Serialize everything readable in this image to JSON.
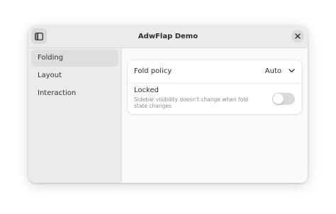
{
  "window": {
    "title": "AdwFlap Demo"
  },
  "headerbar": {
    "sidebar_toggle_icon": "sidebar-show-icon",
    "close_icon": "close-icon"
  },
  "sidebar": {
    "items": [
      {
        "label": "Folding",
        "selected": true
      },
      {
        "label": "Layout",
        "selected": false
      },
      {
        "label": "Interaction",
        "selected": false
      }
    ]
  },
  "settings": {
    "fold_policy": {
      "label": "Fold policy",
      "value": "Auto",
      "icon": "chevron-down-icon"
    },
    "locked": {
      "title": "Locked",
      "subtitle": "Sidebar visibility doesn't change when fold state changes",
      "enabled": false
    }
  },
  "colors": {
    "headerbar": "#ebebeb",
    "sidebar": "#ebebeb",
    "selected_item": "#dedede",
    "content": "#fafafa",
    "card": "#ffffff",
    "switch_off": "#d9d9d9"
  }
}
